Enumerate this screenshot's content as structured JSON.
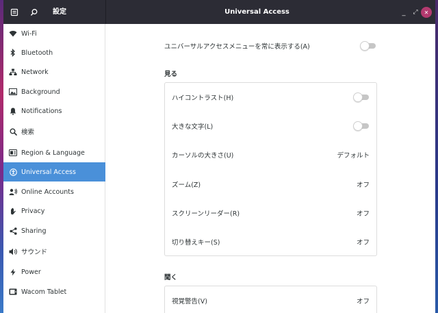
{
  "window": {
    "app_title": "設定",
    "title": "Universal Access",
    "controls": {
      "minimize": "_",
      "maximize": "⤢",
      "close": "✕"
    }
  },
  "sidebar": {
    "items": [
      {
        "label": "Wi-Fi",
        "icon": "wifi-icon"
      },
      {
        "label": "Bluetooth",
        "icon": "bluetooth-icon"
      },
      {
        "label": "Network",
        "icon": "network-icon"
      },
      {
        "label": "Background",
        "icon": "background-icon"
      },
      {
        "label": "Notifications",
        "icon": "bell-icon"
      },
      {
        "label": "検索",
        "icon": "search-icon"
      },
      {
        "label": "Region & Language",
        "icon": "region-icon"
      },
      {
        "label": "Universal Access",
        "icon": "accessibility-icon",
        "active": true
      },
      {
        "label": "Online Accounts",
        "icon": "online-accounts-icon"
      },
      {
        "label": "Privacy",
        "icon": "hand-icon"
      },
      {
        "label": "Sharing",
        "icon": "share-icon"
      },
      {
        "label": "サウンド",
        "icon": "speaker-icon"
      },
      {
        "label": "Power",
        "icon": "power-icon"
      },
      {
        "label": "Wacom Tablet",
        "icon": "tablet-icon"
      }
    ]
  },
  "main": {
    "always_show_menu": {
      "label": "ユニバーサルアクセスメニューを常に表示する(A)",
      "on": false
    },
    "seeing": {
      "title": "見る",
      "rows": [
        {
          "label": "ハイコントラスト(H)",
          "type": "switch",
          "on": false
        },
        {
          "label": "大きな文字(L)",
          "type": "switch",
          "on": false
        },
        {
          "label": "カーソルの大きさ(U)",
          "type": "value",
          "value": "デフォルト"
        },
        {
          "label": "ズーム(Z)",
          "type": "value",
          "value": "オフ"
        },
        {
          "label": "スクリーンリーダー(R)",
          "type": "value",
          "value": "オフ"
        },
        {
          "label": "切り替えキー(S)",
          "type": "value",
          "value": "オフ"
        }
      ]
    },
    "hearing": {
      "title": "聞く",
      "rows": [
        {
          "label": "視覚警告(V)",
          "type": "value",
          "value": "オフ"
        }
      ]
    }
  },
  "colors": {
    "accent": "#4a90d9",
    "headerbar": "#2c2c35",
    "close_button": "#b33a6f"
  }
}
